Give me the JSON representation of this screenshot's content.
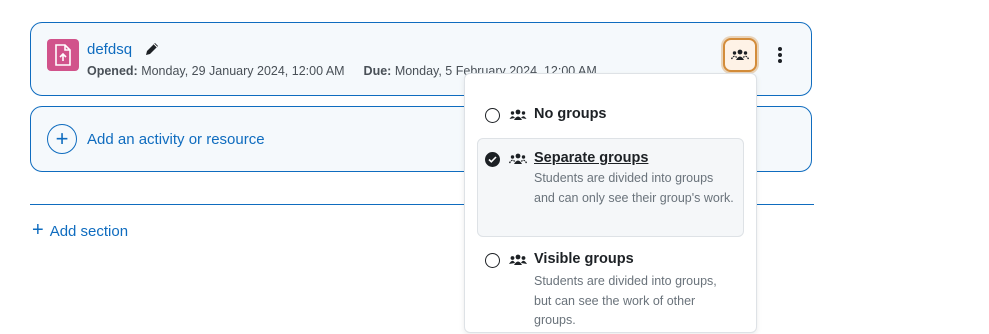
{
  "activity": {
    "name": "defdsq",
    "opened_label": "Opened:",
    "opened_value": "Monday, 29 January 2024, 12:00 AM",
    "due_label": "Due:",
    "due_value": "Monday, 5 February 2024, 12:00 AM",
    "icon_color": "#d1538b"
  },
  "add_activity": {
    "label": "Add an activity or resource"
  },
  "add_section": {
    "label": "Add section"
  },
  "group_menu": {
    "options": [
      {
        "title": "No groups",
        "description": "",
        "selected": false
      },
      {
        "title": "Separate groups",
        "description": "Students are divided into groups and can only see their group's work.",
        "selected": true
      },
      {
        "title": "Visible groups",
        "description": "Students are divided into groups, but can see the work of other groups.",
        "selected": false
      }
    ]
  },
  "colors": {
    "accent": "#0f6cbf",
    "focus": "#d38c3a",
    "icon_pink": "#d1538b"
  }
}
